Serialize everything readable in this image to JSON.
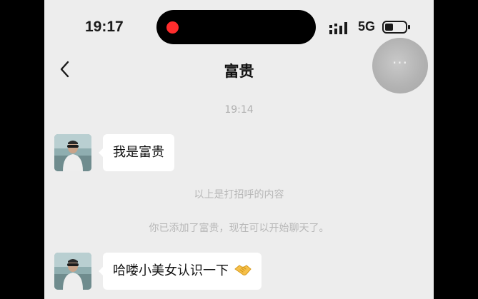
{
  "status_bar": {
    "time": "19:17",
    "network": "5G",
    "icons": [
      "recording-dot-icon",
      "signal-bars-icon",
      "battery-icon"
    ]
  },
  "header": {
    "title": "富贵",
    "back_icon": "chevron-left-icon",
    "more_icon": "more-dots-icon",
    "more_label": "···"
  },
  "chat": {
    "timestamp": "19:14",
    "messages": [
      {
        "sender": "富贵",
        "text": "我是富贵"
      },
      {
        "sender": "富贵",
        "text": "哈喽小美女认识一下",
        "emoji": "handshake-emoji-icon"
      }
    ],
    "system_notices": [
      "以上是打招呼的内容",
      "你已添加了富贵，现在可以开始聊天了。"
    ]
  },
  "colors": {
    "background": "#ededed",
    "bubble": "#ffffff",
    "recording": "#ff2d2d",
    "system_text": "#b7b7b7"
  }
}
